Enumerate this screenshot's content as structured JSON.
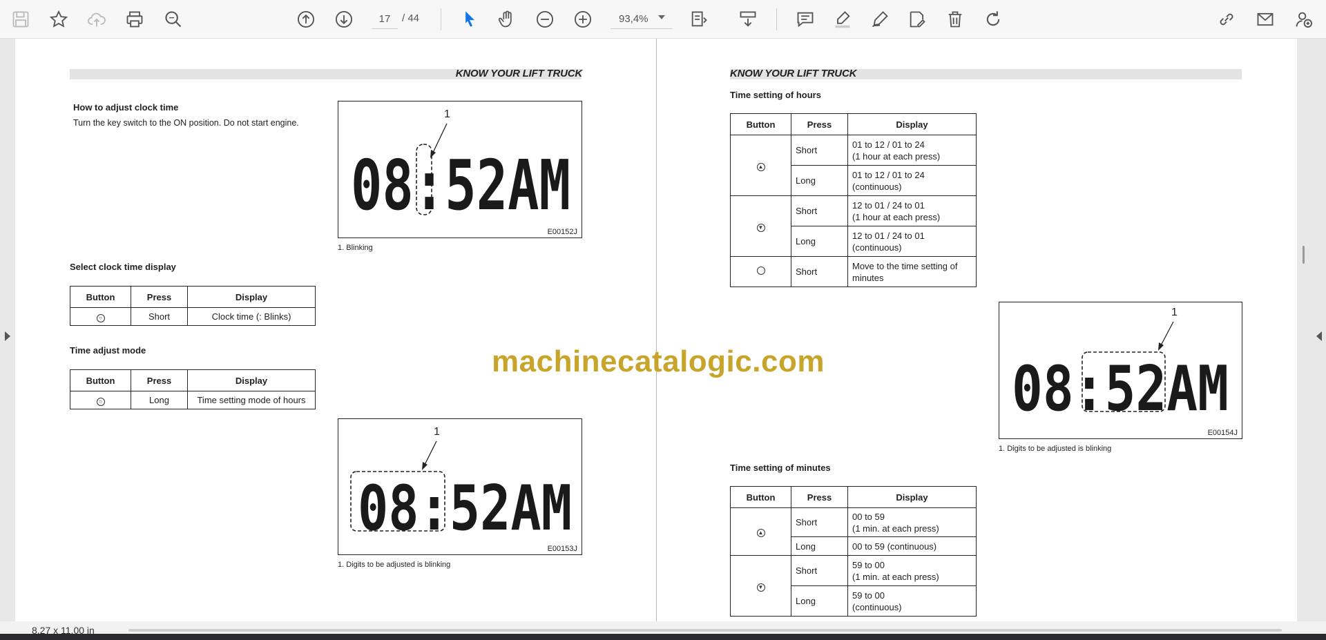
{
  "toolbar": {
    "current_page": "17",
    "total_pages": "/ 44",
    "zoom": "93,4%"
  },
  "left_page": {
    "header": "KNOW YOUR LIFT TRUCK",
    "adjust_title": "How to adjust clock time",
    "adjust_text": "Turn the key switch to the ON position. Do not start engine.",
    "fig1": {
      "label": "1",
      "code": "E00152J",
      "caption": "1. Blinking",
      "display": "08:52AM"
    },
    "select_title": "Select clock time display",
    "select_table": {
      "headers": [
        "Button",
        "Press",
        "Display"
      ],
      "rows": [
        {
          "button": "○",
          "press": "Short",
          "display": "Clock time (: Blinks)"
        }
      ]
    },
    "mode_title": "Time adjust mode",
    "mode_table": {
      "headers": [
        "Button",
        "Press",
        "Display"
      ],
      "rows": [
        {
          "button": "○",
          "press": "Long",
          "display": "Time setting mode of hours"
        }
      ]
    },
    "fig2": {
      "label": "1",
      "code": "E00153J",
      "caption": "1. Digits to be adjusted is blinking",
      "display": "08:52AM"
    }
  },
  "right_page": {
    "header": "KNOW YOUR LIFT TRUCK",
    "hours_title": "Time setting of hours",
    "hours_table": {
      "headers": [
        "Button",
        "Press",
        "Display"
      ],
      "rows": [
        {
          "press": "Short",
          "display": [
            "01 to 12 / 01 to 24",
            "(1 hour at each press)"
          ]
        },
        {
          "press": "Long",
          "display": [
            "01 to 12 / 01 to 24",
            "(continuous)"
          ]
        },
        {
          "press": "Short",
          "display": [
            "12 to 01 / 24 to 01",
            "(1 hour at each press)"
          ]
        },
        {
          "press": "Long",
          "display": [
            "12 to 01 / 24 to 01",
            "(continuous)"
          ]
        },
        {
          "press": "Short",
          "display": [
            "Move to the time setting of",
            "minutes"
          ]
        }
      ]
    },
    "fig3": {
      "label": "1",
      "code": "E00154J",
      "caption": "1. Digits to be adjusted is blinking",
      "display": "08:52AM"
    },
    "minutes_title": "Time setting of minutes",
    "minutes_table": {
      "headers": [
        "Button",
        "Press",
        "Display"
      ],
      "rows": [
        {
          "press": "Short",
          "display": [
            "00 to 59",
            " (1 min. at each press)"
          ]
        },
        {
          "press": "Long",
          "display": [
            "00 to 59 (continuous)"
          ]
        },
        {
          "press": "Short",
          "display": [
            "59 to 00",
            "(1 min. at each press)"
          ]
        },
        {
          "press": "Long",
          "display": [
            "59 to 00",
            "(continuous)"
          ]
        }
      ]
    }
  },
  "watermark": "machinecatalogic.com",
  "status": {
    "page_size": "8,27 x 11,00 in"
  },
  "colors": {
    "watermark": "#c8a52a",
    "active_tool": "#1473e6",
    "toolbar_icon": "#555555"
  }
}
